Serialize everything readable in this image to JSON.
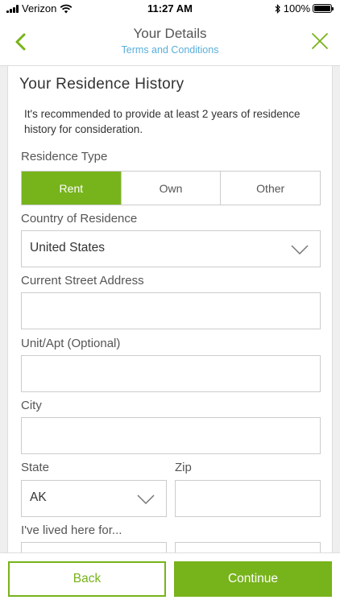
{
  "status_bar": {
    "carrier": "Verizon",
    "time": "11:27 AM",
    "battery": "100%"
  },
  "nav": {
    "title": "Your Details",
    "subtitle": "Terms and Conditions"
  },
  "section": {
    "heading": "Your Residence History",
    "intro": "It's recommended to provide at least 2 years of residence history for consideration."
  },
  "residence_type": {
    "label": "Residence Type",
    "options": [
      "Rent",
      "Own",
      "Other"
    ],
    "selected": "Rent"
  },
  "country": {
    "label": "Country of Residence",
    "value": "United States"
  },
  "street": {
    "label": "Current Street Address",
    "value": ""
  },
  "unit": {
    "label": "Unit/Apt (Optional)",
    "value": ""
  },
  "city": {
    "label": "City",
    "value": ""
  },
  "state": {
    "label": "State",
    "value": "AK"
  },
  "zip": {
    "label": "Zip",
    "value": ""
  },
  "duration": {
    "label": "I've lived here for..."
  },
  "footer": {
    "back_label": "Back",
    "continue_label": "Continue"
  },
  "colors": {
    "accent": "#77b31b",
    "link": "#5aaedb"
  }
}
